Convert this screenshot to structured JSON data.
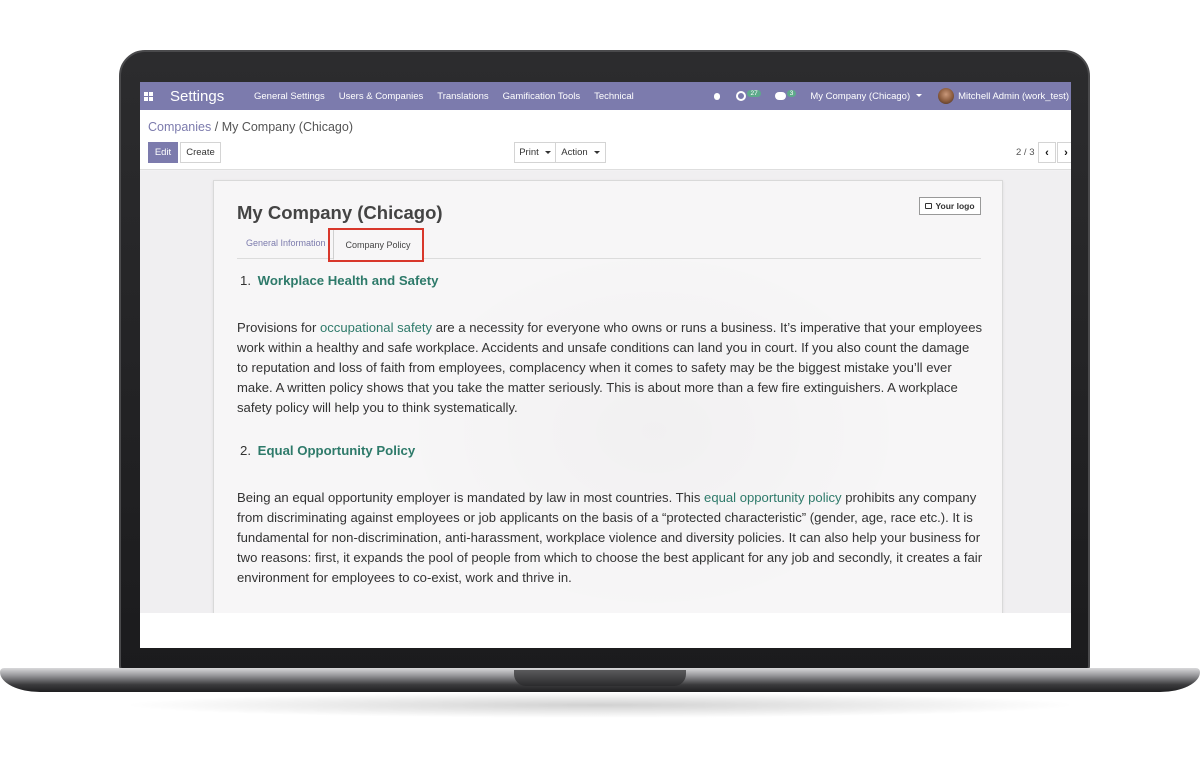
{
  "navbar": {
    "app_title": "Settings",
    "menu": [
      "General Settings",
      "Users & Companies",
      "Translations",
      "Gamification Tools",
      "Technical"
    ],
    "activity_count": "27",
    "message_count": "3",
    "company_switch": "My Company (Chicago)",
    "user": "Mitchell Admin (work_test)"
  },
  "breadcrumb": {
    "parent": "Companies",
    "separator": "/",
    "current": "My Company (Chicago)"
  },
  "buttons": {
    "edit": "Edit",
    "create": "Create",
    "print": "Print",
    "action": "Action"
  },
  "pager": {
    "value": "2 / 3"
  },
  "form": {
    "company_name": "My Company (Chicago)",
    "logo_label": "Your logo",
    "tabs": {
      "general": "General Information",
      "policy": "Company Policy"
    }
  },
  "policy": {
    "section1": {
      "number": "1.",
      "title": "Workplace Health and Safety",
      "text_before": "Provisions for ",
      "link": "occupational safety",
      "text_after": " are a necessity for everyone who owns or runs a business. It’s imperative that your employees work within a healthy and safe workplace. Accidents and unsafe conditions can land you in court. If you also count the damage to reputation and loss of faith from employees, complacency when it comes to safety may be the biggest mistake you’ll ever make. A written policy shows that you take the matter seriously. This is about more than a few fire extinguishers. A workplace safety policy will help you to think systematically."
    },
    "section2": {
      "number": "2.",
      "title": "Equal Opportunity Policy",
      "text_before": "Being an equal opportunity employer is mandated by law in most countries. This ",
      "link": "equal opportunity policy",
      "text_after": " prohibits any company from discriminating against employees or job applicants on the basis of a “protected characteristic” (gender, age, race etc.). It is fundamental for non-discrimination, anti-harassment, workplace violence and diversity policies. It can also help your business for two reasons: first, it expands the pool of people from which to choose the best applicant for any job and secondly, it creates a fair environment for employees to co-exist, work and thrive in."
    }
  },
  "colors": {
    "navbar": "#7c7bad",
    "link": "#2e7a6a",
    "highlight": "#d8372b"
  }
}
